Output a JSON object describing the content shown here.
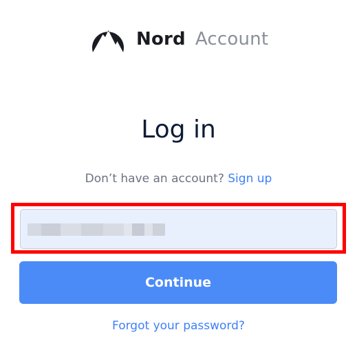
{
  "brand": {
    "name": "Nord",
    "subtitle": "Account",
    "logo_icon": "nord-mountain-logo-icon"
  },
  "login": {
    "title": "Log in",
    "signup_prompt": "Don’t have an account?",
    "signup_link": "Sign up",
    "email_value_redacted": true,
    "continue_label": "Continue",
    "forgot_password_label": "Forgot your password?"
  },
  "colors": {
    "accent": "#4b8bf8",
    "link": "#3e80f7",
    "input_autofill_bg": "#e8f0fe",
    "highlight_border": "#ff0000",
    "title_text": "#0e1c36"
  }
}
